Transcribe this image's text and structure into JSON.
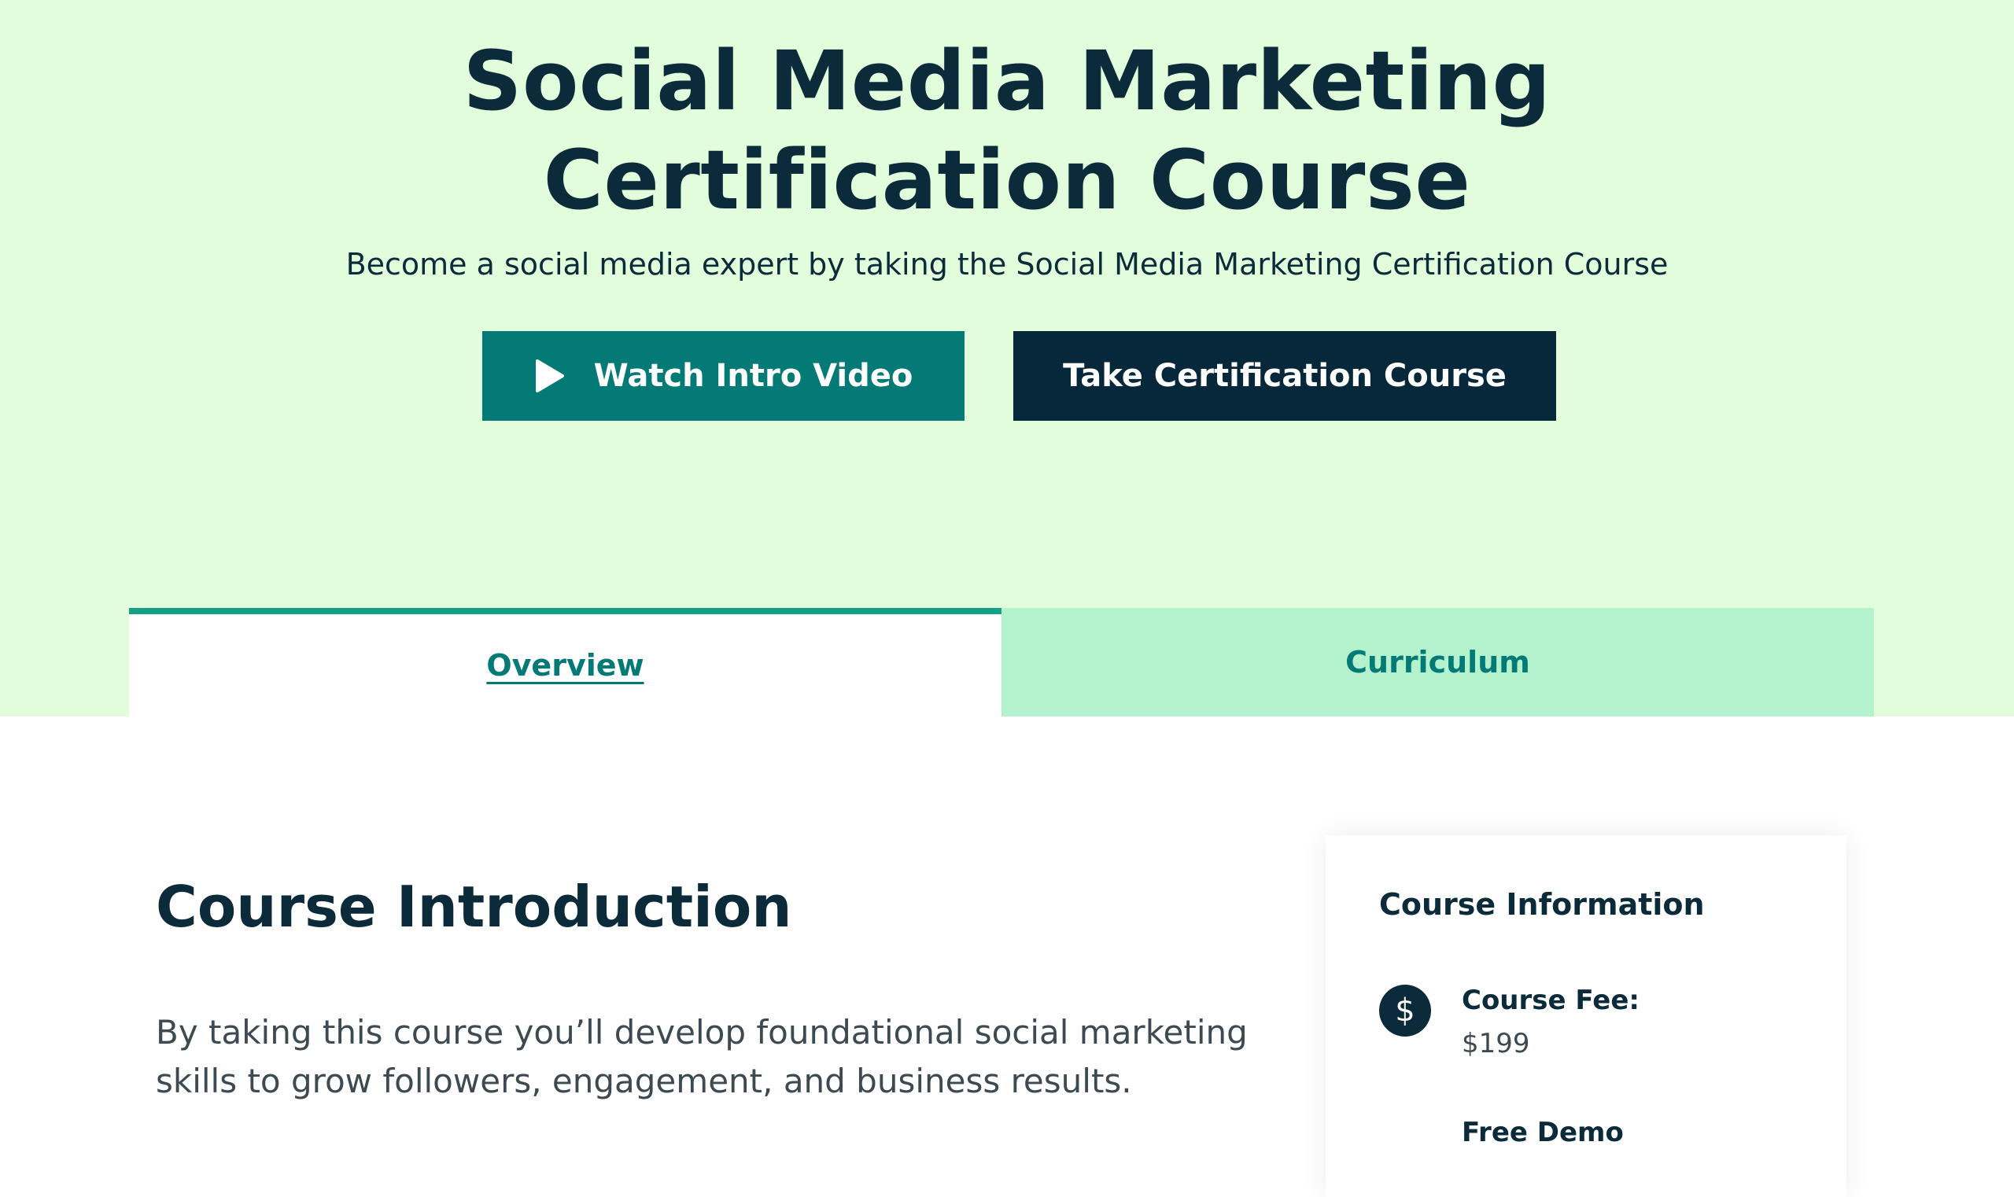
{
  "hero": {
    "title": "Social Media Marketing Certification Course",
    "subtitle": "Become a social media expert by taking the Social Media Marketing Certification Course",
    "watch_video_label": "Watch Intro Video",
    "take_course_label": "Take Certification Course",
    "play_icon": "play-icon"
  },
  "tabs": [
    {
      "label": "Overview",
      "active": true
    },
    {
      "label": "Curriculum",
      "active": false
    }
  ],
  "intro": {
    "title": "Course Introduction",
    "text": "By taking this course you’ll develop foundational social marketing skills to grow followers, engagement, and business results."
  },
  "course_info": {
    "title": "Course Information",
    "fee_icon_symbol": "$",
    "fee_label": "Course Fee:",
    "fee_value": "$199",
    "demo_label": "Free Demo"
  },
  "colors": {
    "hero_bg": "#e1fddc",
    "primary_teal": "#047a76",
    "dark_navy": "#06283a",
    "tab_inactive_bg": "#b3f2cc",
    "tab_active_border": "#17a085"
  }
}
